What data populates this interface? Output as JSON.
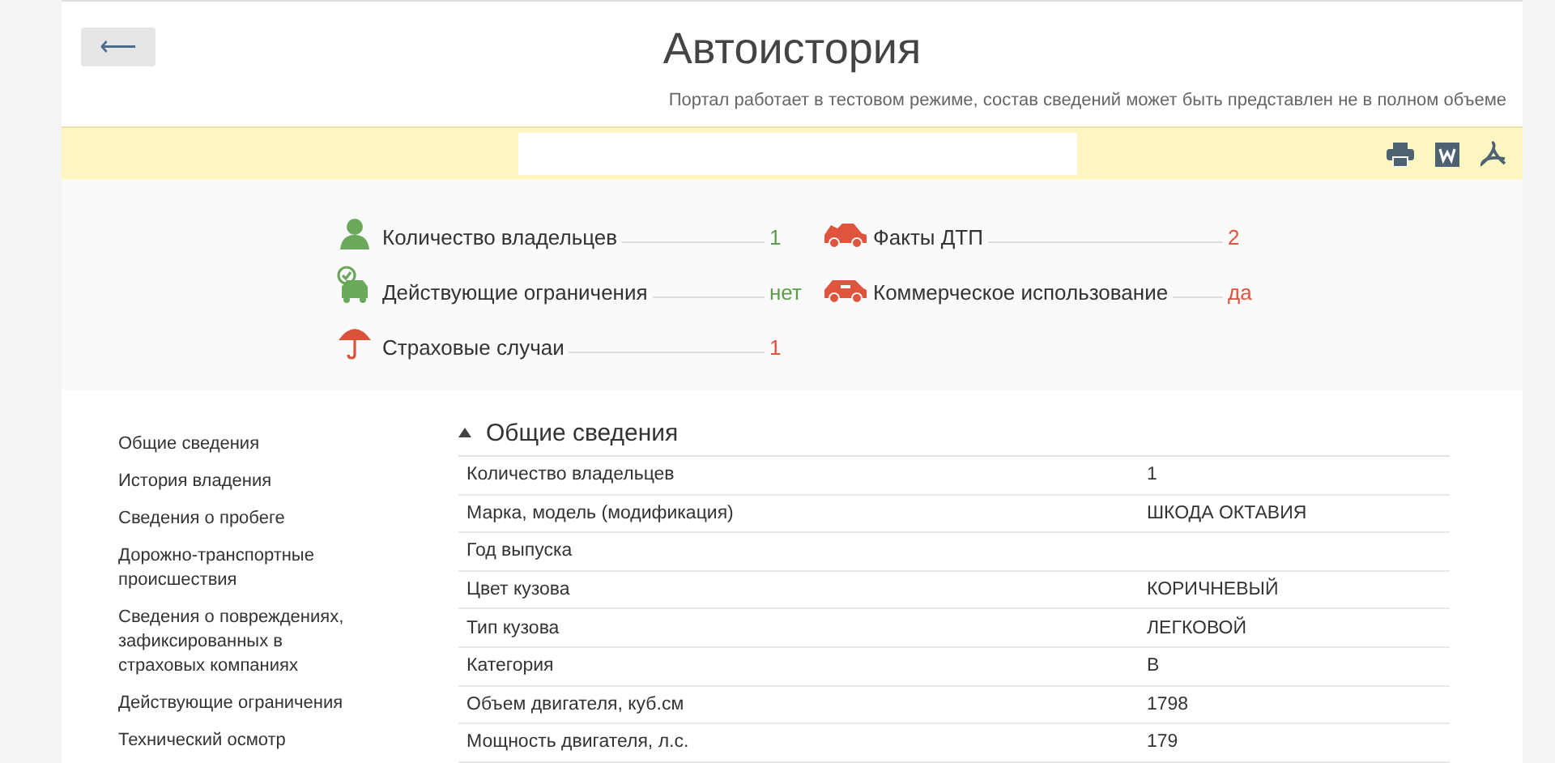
{
  "header": {
    "back_button": "⟵",
    "title": "Автоистория",
    "notice": "Портал работает в тестовом режиме, состав сведений может быть представлен не в полном объеме"
  },
  "toolbar": {
    "actions": [
      {
        "kind": "print"
      },
      {
        "kind": "word"
      },
      {
        "kind": "pdf"
      }
    ]
  },
  "summary": [
    {
      "kind": "person",
      "label": "Количество владельцев",
      "value": "1",
      "color": "#5a9e4b"
    },
    {
      "kind": "crash",
      "label": "Факты ДТП",
      "value": "2",
      "color": "#e0533d"
    },
    {
      "kind": "car-check",
      "label": "Действующие ограничения",
      "value": "нет",
      "color": "#5a9e4b"
    },
    {
      "kind": "taxi",
      "label": "Коммерческое использование",
      "value": "да",
      "color": "#e0533d"
    },
    {
      "kind": "umbrella",
      "label": "Страховые случаи",
      "value": "1",
      "color": "#e0533d"
    }
  ],
  "sidebar": {
    "items": [
      "Общие сведения",
      "История владения",
      "Сведения о пробеге",
      "Дорожно-транспортные происшествия",
      "Сведения о повреждениях, зафиксированных в страховых компаниях",
      "Действующие ограничения",
      "Технический осмотр"
    ]
  },
  "section": {
    "title": "Общие сведения",
    "expanded": true,
    "rows": [
      {
        "label": "Количество владельцев",
        "value": "1"
      },
      {
        "label": "Марка, модель (модификация)",
        "value": "ШКОДА ОКТАВИЯ"
      },
      {
        "label": "Год выпуска"
      },
      {
        "label": "Цвет кузова",
        "value": "КОРИЧНЕВЫЙ"
      },
      {
        "label": "Тип кузова",
        "value": "ЛЕГКОВОЙ"
      },
      {
        "label": "Категория",
        "value": "B"
      },
      {
        "label": "Объем двигателя, куб.см",
        "value": "1798"
      },
      {
        "label": "Мощность двигателя, л.с.",
        "value": "179"
      }
    ]
  }
}
